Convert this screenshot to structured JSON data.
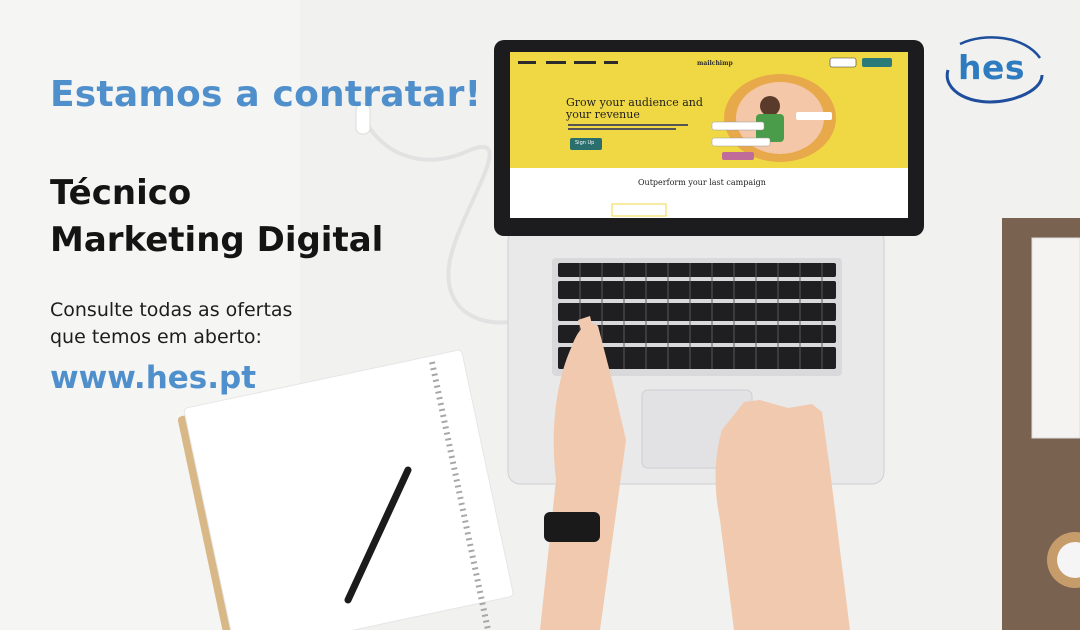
{
  "ad": {
    "headline": "Estamos a contratar!",
    "title_line1": "Técnico",
    "title_line2": "Marketing Digital",
    "sub_line1": "Consulte todas as ofertas",
    "sub_line2": "que temos em aberto:",
    "url": "www.hes.pt"
  },
  "logo": {
    "text": "hes"
  },
  "laptop_screen": {
    "brand": "mailchimp",
    "hero_line1": "Grow your audience and",
    "hero_line2": "your revenue",
    "cta": "Sign Up",
    "section": "Outperform your last campaign"
  },
  "colors": {
    "accent_blue": "#4f8fcb",
    "logo_blue": "#2e7bbf",
    "screen_yellow": "#f0d844",
    "title_text": "#141414"
  }
}
